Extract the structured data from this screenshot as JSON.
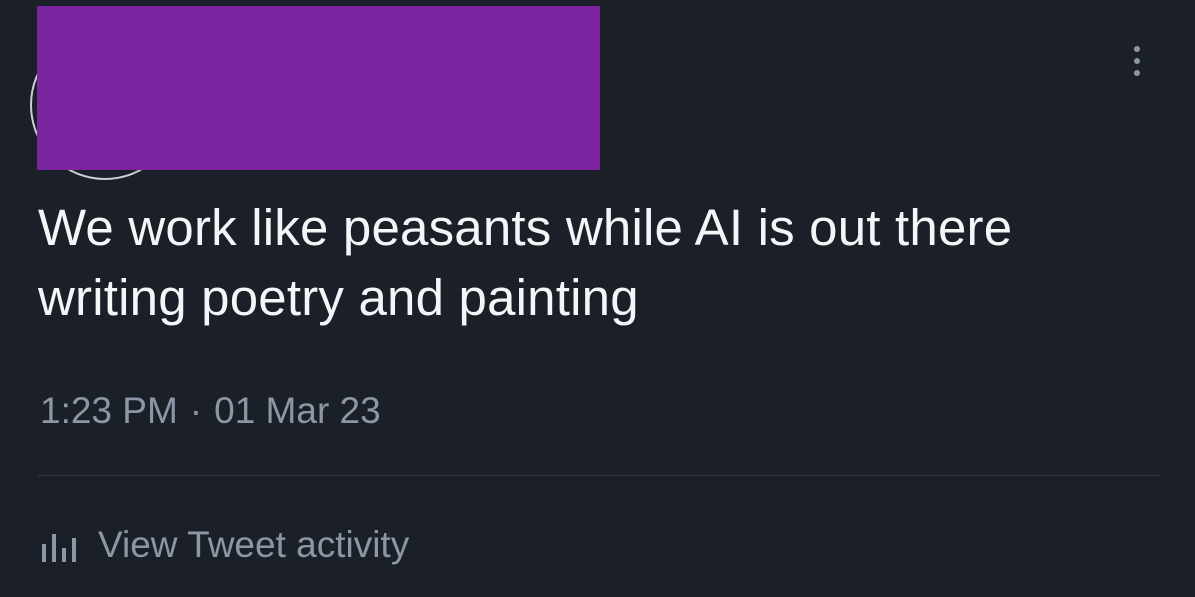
{
  "tweet": {
    "text": "We work like peasants while AI is out there writing poetry and painting",
    "time": "1:23 PM",
    "separator": "·",
    "date": "01 Mar 23"
  },
  "activity": {
    "label": "View Tweet activity",
    "icon": "bar-chart-icon"
  },
  "header": {
    "menu_icon": "more-options-icon"
  },
  "colors": {
    "background": "#1a1f28",
    "text": "#f3f5f7",
    "secondary_text": "#8b97a4",
    "redaction": "#7c23a0",
    "divider": "#343c47"
  }
}
